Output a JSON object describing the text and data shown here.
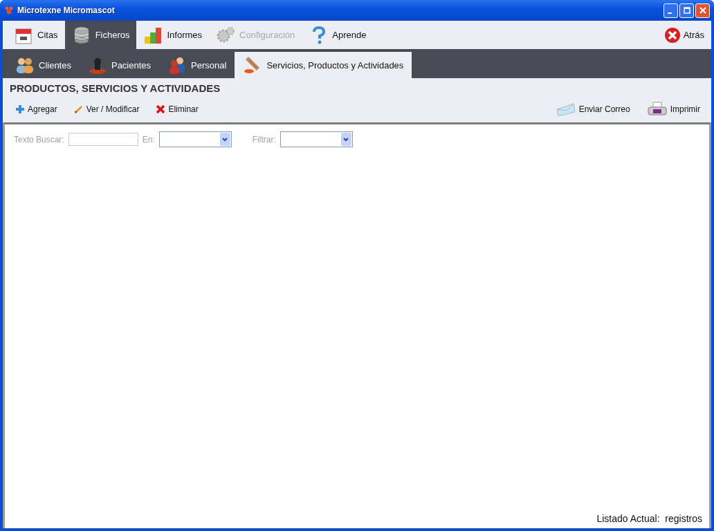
{
  "window": {
    "title": "Microtexne Micromascot"
  },
  "main_tabs": [
    {
      "label": "Citas",
      "selected": false,
      "disabled": false
    },
    {
      "label": "Ficheros",
      "selected": true,
      "disabled": false
    },
    {
      "label": "Informes",
      "selected": false,
      "disabled": false
    },
    {
      "label": "Configuración",
      "selected": false,
      "disabled": true
    },
    {
      "label": "Aprende",
      "selected": false,
      "disabled": false
    }
  ],
  "back_button": "Atrás",
  "sub_tabs": [
    {
      "label": "Clientes",
      "selected": false
    },
    {
      "label": "Pacientes",
      "selected": false
    },
    {
      "label": "Personal",
      "selected": false
    },
    {
      "label": "Servicios, Productos y Actividades",
      "selected": true
    }
  ],
  "section_title": "PRODUCTOS, SERVICIOS Y ACTIVIDADES",
  "toolbar_left": [
    "Agregar",
    "Ver / Modificar",
    "Eliminar"
  ],
  "toolbar_right": [
    "Enviar Correo",
    "Imprimir"
  ],
  "filters": {
    "search_label": "Texto Buscar:",
    "in_label": "En:",
    "filter_label": "Filtrar:"
  },
  "status": "Listado Actual:  registros"
}
